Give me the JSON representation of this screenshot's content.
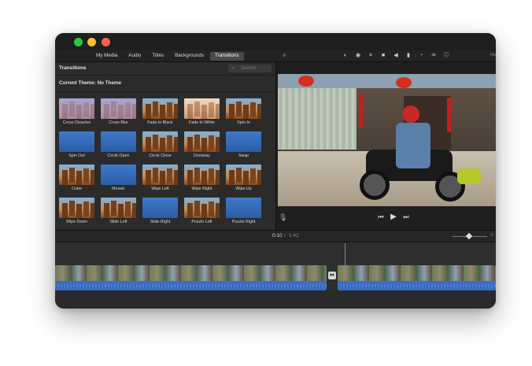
{
  "window": {
    "traffic_lights": [
      "green",
      "yellow",
      "red"
    ],
    "colors": {
      "green": "#28c840",
      "yellow": "#febc2e",
      "red": "#ff5f57"
    }
  },
  "tabs": [
    {
      "label": "My Media",
      "active": false
    },
    {
      "label": "Audio",
      "active": false
    },
    {
      "label": "Titles",
      "active": false
    },
    {
      "label": "Backgrounds",
      "active": false
    },
    {
      "label": "Transitions",
      "active": true
    }
  ],
  "viewer_toolbar": {
    "icons": [
      "magic-wand-icon",
      "color-balance-icon",
      "color-correction-icon",
      "crop-icon",
      "stabilization-icon",
      "volume-icon",
      "equalizer-icon",
      "speed-icon",
      "noise-reduction-icon",
      "info-icon"
    ],
    "reset_label": "Re"
  },
  "browser": {
    "title": "Transitions",
    "search_placeholder": "Search",
    "theme_label": "Current Theme: No Theme",
    "transitions": [
      {
        "label": "Cross Dissolve",
        "style": "fade"
      },
      {
        "label": "Cross Blur",
        "style": "fade"
      },
      {
        "label": "Fade to Black",
        "style": "scene"
      },
      {
        "label": "Fade to White",
        "style": "white"
      },
      {
        "label": "Spin In",
        "style": "scene"
      },
      {
        "label": "Spin Out",
        "style": "blue"
      },
      {
        "label": "Circle Open",
        "style": "blue"
      },
      {
        "label": "Circle Close",
        "style": "scene"
      },
      {
        "label": "Doorway",
        "style": "scene"
      },
      {
        "label": "Swap",
        "style": "blue"
      },
      {
        "label": "Cube",
        "style": "scene"
      },
      {
        "label": "Mosaic",
        "style": "blue"
      },
      {
        "label": "Wipe Left",
        "style": "scene"
      },
      {
        "label": "Wipe Right",
        "style": "scene"
      },
      {
        "label": "Wipe Up",
        "style": "scene"
      },
      {
        "label": "Wipe Down",
        "style": "scene"
      },
      {
        "label": "Slide Left",
        "style": "scene"
      },
      {
        "label": "Slide Right",
        "style": "blue"
      },
      {
        "label": "Puzzle Left",
        "style": "scene"
      },
      {
        "label": "Puzzle Right",
        "style": "blue"
      }
    ]
  },
  "timeline": {
    "current_time": "0:10",
    "separator": "/",
    "total_time": "1:42",
    "settings_label": "S"
  }
}
